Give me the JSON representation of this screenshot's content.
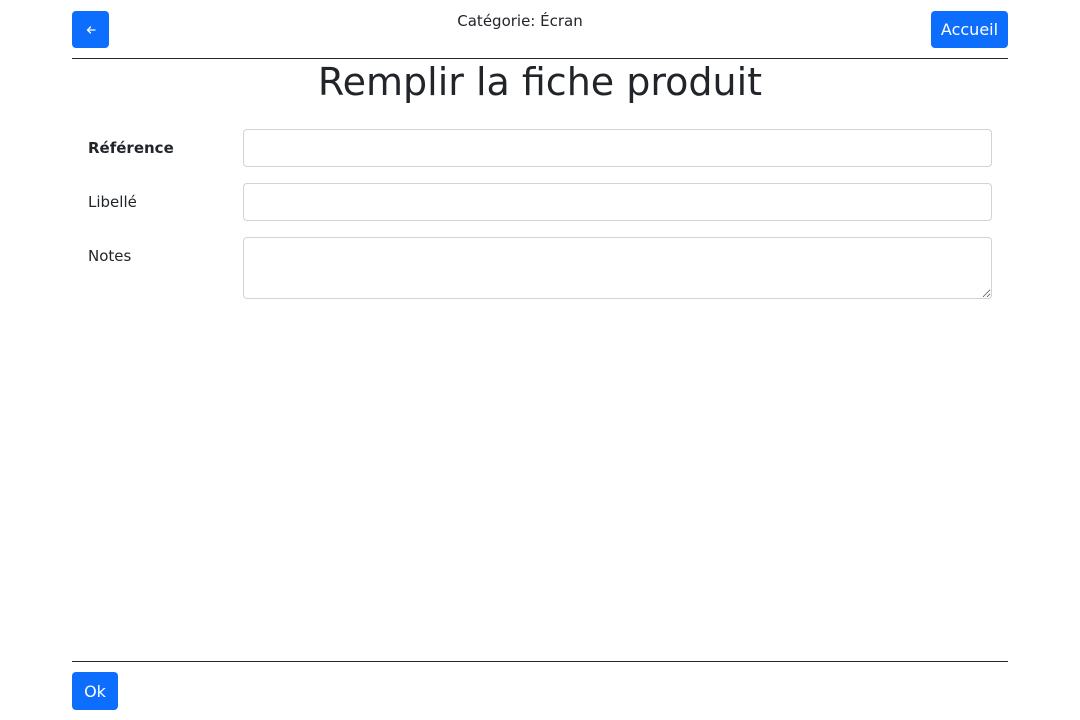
{
  "header": {
    "back_icon": "arrow-left-icon",
    "category_text": "Catégorie: Écran",
    "home_label": "Accueil"
  },
  "main": {
    "title": "Remplir la fiche produit",
    "fields": [
      {
        "label": "Référence",
        "value": "",
        "bold": true
      },
      {
        "label": "Libellé",
        "value": ""
      },
      {
        "label": "Notes",
        "value": ""
      }
    ]
  },
  "footer": {
    "ok_label": "Ok"
  },
  "colors": {
    "accent": "#0d6efd",
    "text": "#212529",
    "input_border": "#ced4da"
  }
}
